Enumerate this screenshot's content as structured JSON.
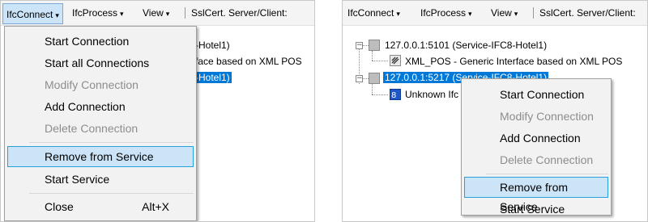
{
  "left": {
    "menubar": {
      "ifcconnect": "IfcConnect",
      "ifcprocess": "IfcProcess",
      "view": "View",
      "sslcert": "SslCert. Server/Client:",
      "caret": "▾"
    },
    "tree": {
      "node1_partial": "-Hotel1)",
      "child_partial": "face based on XML POS",
      "node2_partial": "-Hotel1)"
    },
    "menu": {
      "start_connection": "Start Connection",
      "start_all": "Start all Connections",
      "modify": "Modify Connection",
      "add": "Add Connection",
      "delete": "Delete Connection",
      "remove": "Remove from Service",
      "start_service": "Start Service",
      "close": "Close",
      "close_shortcut": "Alt+X"
    }
  },
  "right": {
    "menubar": {
      "ifcconnect": "IfcConnect",
      "ifcprocess": "IfcProcess",
      "view": "View",
      "sslcert": "SslCert. Server/Client:",
      "caret": "▾"
    },
    "tree": {
      "node1": "127.0.0.1:5101 (Service-IFC8-Hotel1)",
      "child1": "XML_POS - Generic Interface based on XML POS",
      "node2": "127.0.0.1:5217 (Service-IFC8-Hotel1)",
      "child2_partial": "Unknown Ifc",
      "expander": "−"
    },
    "menu": {
      "start_connection": "Start Connection",
      "modify": "Modify Connection",
      "add": "Add Connection",
      "delete": "Delete Connection",
      "remove": "Remove from Service",
      "start_service": "Start Service"
    }
  },
  "colors": {
    "selection": "#0078d7",
    "highlight_bg": "#cce4f7",
    "highlight_border": "#26a0da",
    "disabled_text": "#8d8d8d"
  }
}
